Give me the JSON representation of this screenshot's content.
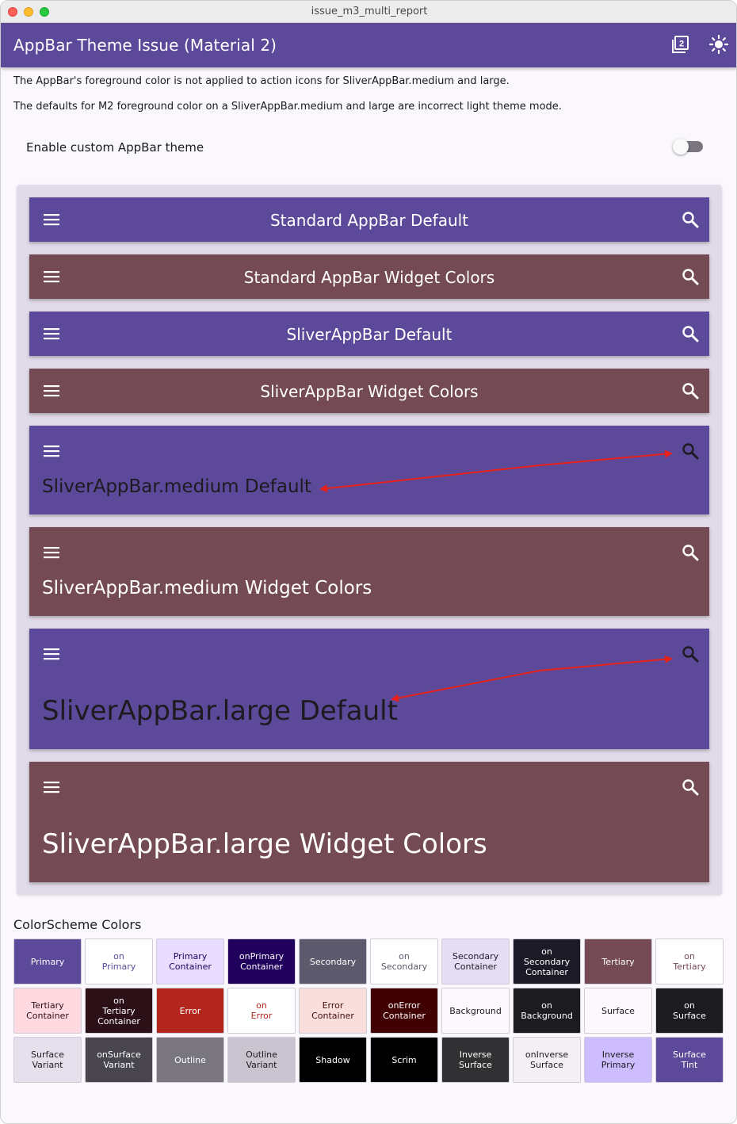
{
  "window": {
    "title": "issue_m3_multi_report"
  },
  "appbar": {
    "title": "AppBar Theme Issue (Material 2)",
    "actions": [
      "dashboard-icon",
      "theme-mode-icon"
    ]
  },
  "description": {
    "line1": "The AppBar's foreground color is not applied to action icons for SliverAppBar.medium and large.",
    "line2": "The defaults for M2 foreground color on a SliverAppBar.medium and large are incorrect light theme mode."
  },
  "toggle": {
    "label": "Enable custom AppBar theme",
    "checked": false
  },
  "bars": [
    {
      "title": "Standard AppBar Default",
      "style": "standard",
      "color": "#5c4999"
    },
    {
      "title": "Standard AppBar Widget Colors",
      "style": "standard",
      "color": "#744a54"
    },
    {
      "title": "SliverAppBar Default",
      "style": "standard",
      "color": "#5c4999"
    },
    {
      "title": "SliverAppBar Widget Colors",
      "style": "standard",
      "color": "#744a54"
    },
    {
      "title": "SliverAppBar.medium Default",
      "style": "medium",
      "color": "#5c4999"
    },
    {
      "title": "SliverAppBar.medium Widget Colors",
      "style": "medium",
      "color": "#744a54"
    },
    {
      "title": "SliverAppBar.large Default",
      "style": "large",
      "color": "#5c4999"
    },
    {
      "title": "SliverAppBar.large Widget Colors",
      "style": "large",
      "color": "#744a54"
    }
  ],
  "colorscheme": {
    "heading": "ColorScheme Colors",
    "swatches": [
      {
        "label": "Primary",
        "bg": "#5c4999",
        "fg": "#ffffff"
      },
      {
        "label": "on\nPrimary",
        "bg": "#ffffff",
        "fg": "#5c4999"
      },
      {
        "label": "Primary\nContainer",
        "bg": "#e8ddff",
        "fg": "#21005d"
      },
      {
        "label": "onPrimary\nContainer",
        "bg": "#21005d",
        "fg": "#ffffff"
      },
      {
        "label": "Secondary",
        "bg": "#5e5a6d",
        "fg": "#ffffff"
      },
      {
        "label": "on\nSecondary",
        "bg": "#ffffff",
        "fg": "#5e5a6d"
      },
      {
        "label": "Secondary\nContainer",
        "bg": "#e4ddf4",
        "fg": "#1c1a26"
      },
      {
        "label": "on\nSecondary\nContainer",
        "bg": "#1c1a26",
        "fg": "#ffffff"
      },
      {
        "label": "Tertiary",
        "bg": "#744a54",
        "fg": "#ffffff"
      },
      {
        "label": "on\nTertiary",
        "bg": "#ffffff",
        "fg": "#744a54"
      },
      {
        "label": "Tertiary\nContainer",
        "bg": "#ffd9df",
        "fg": "#2c1017"
      },
      {
        "label": "on\nTertiary\nContainer",
        "bg": "#2c1017",
        "fg": "#ffffff"
      },
      {
        "label": "Error",
        "bg": "#b3261e",
        "fg": "#ffffff"
      },
      {
        "label": "on\nError",
        "bg": "#ffffff",
        "fg": "#b3261e"
      },
      {
        "label": "Error\nContainer",
        "bg": "#f9dedc",
        "fg": "#410e0b"
      },
      {
        "label": "onError\nContainer",
        "bg": "#410002",
        "fg": "#ffffff"
      },
      {
        "label": "Background",
        "bg": "#fcf8fd",
        "fg": "#1c1b1f"
      },
      {
        "label": "on\nBackground",
        "bg": "#1c1b1f",
        "fg": "#ffffff"
      },
      {
        "label": "Surface",
        "bg": "#fcf8fd",
        "fg": "#1c1b1f"
      },
      {
        "label": "on\nSurface",
        "bg": "#1c1b1f",
        "fg": "#ffffff"
      },
      {
        "label": "Surface\nVariant",
        "bg": "#e5e0ec",
        "fg": "#1c1b1f"
      },
      {
        "label": "onSurface\nVariant",
        "bg": "#48454e",
        "fg": "#ffffff"
      },
      {
        "label": "Outline",
        "bg": "#79767f",
        "fg": "#ffffff"
      },
      {
        "label": "Outline\nVariant",
        "bg": "#c9c4cf",
        "fg": "#1c1b1f"
      },
      {
        "label": "Shadow",
        "bg": "#000000",
        "fg": "#ffffff"
      },
      {
        "label": "Scrim",
        "bg": "#000000",
        "fg": "#ffffff"
      },
      {
        "label": "Inverse\nSurface",
        "bg": "#313033",
        "fg": "#ffffff"
      },
      {
        "label": "onInverse\nSurface",
        "bg": "#f4eff4",
        "fg": "#1c1b1f"
      },
      {
        "label": "Inverse\nPrimary",
        "bg": "#cdbdff",
        "fg": "#1c1b1f"
      },
      {
        "label": "Surface\nTint",
        "bg": "#5c4999",
        "fg": "#ffffff"
      }
    ]
  }
}
